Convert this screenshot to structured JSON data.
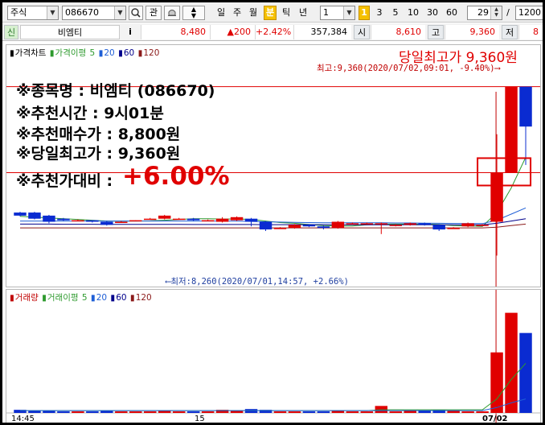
{
  "toolbar": {
    "market_select": "주식",
    "stock_code": "086670",
    "search_icon": "magnifier-icon",
    "btn_watch": "관",
    "period_tabs": [
      "일",
      "주",
      "월",
      "분",
      "틱",
      "년"
    ],
    "interval_value": "1",
    "minute_presets": [
      "3",
      "5",
      "10",
      "30",
      "60"
    ],
    "count_value": "29",
    "slash": "/",
    "total_value": "1200",
    "colors": {
      "active_tab": "#f5c000",
      "up": "#e00000",
      "down": "#0a2bd1"
    }
  },
  "quote": {
    "badge": "신",
    "stock_name": "비엠티",
    "info_btn": "i",
    "price": "8,480",
    "change": "▲200",
    "change_pct": "+2.42%",
    "volume": "357,384",
    "open_label": "시",
    "open": "8,610",
    "high_label": "고",
    "high": "9,360",
    "low_label": "저",
    "low": "8"
  },
  "price_legend": {
    "chart_label": "가격차트",
    "ma_label": "가격이평",
    "ma5": "5",
    "ma20": "20",
    "ma60": "60",
    "ma120": "120"
  },
  "vol_legend": {
    "chart_label": "거래량",
    "ma_label": "거래이평",
    "ma5": "5",
    "ma20": "20",
    "ma60": "60",
    "ma120": "120"
  },
  "annotations": {
    "max_label": "최고:9,360(2020/07/02,09:01, -9.40%)⟶",
    "min_label": "⟵최저:8,260(2020/07/01,14:57, +2.66%)",
    "daily_high_title": "당일최고가 9,360원"
  },
  "overlay": {
    "line1": "※종목명 : 비엠티 (086670)",
    "line2": "※추천시간 : 9시01분",
    "line3": "※추천매수가 : 8,800원",
    "line4": "※당일최고가 : 9,360원",
    "line5_label": "※추천가대비 :",
    "line5_value": "+6.00%"
  },
  "xaxis": {
    "ticks": [
      "14:45",
      "15",
      "07/02"
    ]
  },
  "chart_data": {
    "type": "candlestick",
    "price_range": [
      8100,
      9400
    ],
    "candles": [
      {
        "o": 8540,
        "c": 8520,
        "h": 8545,
        "l": 8515
      },
      {
        "o": 8540,
        "c": 8500,
        "h": 8545,
        "l": 8495
      },
      {
        "o": 8520,
        "c": 8480,
        "h": 8525,
        "l": 8470
      },
      {
        "o": 8500,
        "c": 8490,
        "h": 8505,
        "l": 8485
      },
      {
        "o": 8490,
        "c": 8490,
        "h": 8495,
        "l": 8485
      },
      {
        "o": 8490,
        "c": 8480,
        "h": 8490,
        "l": 8475
      },
      {
        "o": 8480,
        "c": 8460,
        "h": 8485,
        "l": 8455
      },
      {
        "o": 8480,
        "c": 8480,
        "h": 8485,
        "l": 8475
      },
      {
        "o": 8490,
        "c": 8490,
        "h": 8490,
        "l": 8485
      },
      {
        "o": 8500,
        "c": 8500,
        "h": 8505,
        "l": 8495
      },
      {
        "o": 8500,
        "c": 8520,
        "h": 8525,
        "l": 8495
      },
      {
        "o": 8500,
        "c": 8500,
        "h": 8505,
        "l": 8495
      },
      {
        "o": 8500,
        "c": 8490,
        "h": 8505,
        "l": 8485
      },
      {
        "o": 8490,
        "c": 8490,
        "h": 8495,
        "l": 8485
      },
      {
        "o": 8480,
        "c": 8500,
        "h": 8510,
        "l": 8475
      },
      {
        "o": 8490,
        "c": 8510,
        "h": 8515,
        "l": 8485
      },
      {
        "o": 8500,
        "c": 8480,
        "h": 8505,
        "l": 8450
      },
      {
        "o": 8480,
        "c": 8430,
        "h": 8485,
        "l": 8420
      },
      {
        "o": 8440,
        "c": 8440,
        "h": 8445,
        "l": 8435
      },
      {
        "o": 8440,
        "c": 8460,
        "h": 8465,
        "l": 8435
      },
      {
        "o": 8460,
        "c": 8450,
        "h": 8465,
        "l": 8445
      },
      {
        "o": 8450,
        "c": 8440,
        "h": 8455,
        "l": 8430
      },
      {
        "o": 8440,
        "c": 8480,
        "h": 8485,
        "l": 8435
      },
      {
        "o": 8470,
        "c": 8470,
        "h": 8475,
        "l": 8465
      },
      {
        "o": 8470,
        "c": 8470,
        "h": 8475,
        "l": 8465
      },
      {
        "o": 8470,
        "c": 8470,
        "h": 8475,
        "l": 8400
      },
      {
        "o": 8460,
        "c": 8460,
        "h": 8465,
        "l": 8450
      },
      {
        "o": 8460,
        "c": 8470,
        "h": 8475,
        "l": 8455
      },
      {
        "o": 8470,
        "c": 8460,
        "h": 8475,
        "l": 8455
      },
      {
        "o": 8460,
        "c": 8430,
        "h": 8465,
        "l": 8420
      },
      {
        "o": 8440,
        "c": 8440,
        "h": 8445,
        "l": 8435
      },
      {
        "o": 8450,
        "c": 8470,
        "h": 8475,
        "l": 8445
      },
      {
        "o": 8460,
        "c": 8460,
        "h": 8465,
        "l": 8455
      },
      {
        "o": 8480,
        "c": 8800,
        "h": 9050,
        "l": 8260
      },
      {
        "o": 8800,
        "c": 9360,
        "h": 9360,
        "l": 8800
      },
      {
        "o": 9360,
        "c": 9100,
        "h": 9360,
        "l": 8850
      }
    ],
    "volumes": [
      4,
      3,
      3,
      2,
      2,
      2,
      3,
      2,
      2,
      2,
      3,
      2,
      2,
      2,
      4,
      3,
      5,
      4,
      2,
      2,
      2,
      2,
      3,
      2,
      2,
      9,
      2,
      3,
      3,
      4,
      3,
      2,
      2,
      78,
      129,
      103
    ],
    "volume_range": [
      0,
      140
    ],
    "ma5": [
      8515,
      8510,
      8505,
      8500,
      8495,
      8490,
      8485,
      8485,
      8485,
      8486,
      8490,
      8495,
      8500,
      8500,
      8498,
      8498,
      8496,
      8485,
      8475,
      8470,
      8462,
      8455,
      8452,
      8452,
      8460,
      8465,
      8465,
      8465,
      8465,
      8462,
      8455,
      8452,
      8450,
      8540,
      8700,
      8900
    ],
    "ma20": [
      8485,
      8485,
      8485,
      8485,
      8485,
      8485,
      8485,
      8485,
      8485,
      8485,
      8485,
      8485,
      8485,
      8485,
      8485,
      8485,
      8482,
      8480,
      8478,
      8476,
      8475,
      8474,
      8474,
      8474,
      8474,
      8473,
      8472,
      8472,
      8471,
      8470,
      8469,
      8468,
      8468,
      8490,
      8530,
      8570
    ],
    "ma60": [
      8465,
      8465,
      8465,
      8464,
      8464,
      8464,
      8463,
      8463,
      8463,
      8463,
      8463,
      8463,
      8462,
      8462,
      8462,
      8462,
      8462,
      8461,
      8461,
      8461,
      8461,
      8461,
      8461,
      8461,
      8460,
      8460,
      8460,
      8460,
      8460,
      8460,
      8460,
      8460,
      8460,
      8470,
      8485,
      8500
    ],
    "ma120": [
      8440,
      8440,
      8440,
      8440,
      8440,
      8440,
      8440,
      8440,
      8440,
      8440,
      8440,
      8440,
      8440,
      8440,
      8440,
      8440,
      8440,
      8440,
      8440,
      8440,
      8440,
      8440,
      8440,
      8440,
      8440,
      8440,
      8440,
      8440,
      8440,
      8440,
      8440,
      8440,
      8440,
      8445,
      8455,
      8465
    ],
    "vol_ma5": [
      3,
      3,
      3,
      3,
      3,
      3,
      3,
      3,
      3,
      3,
      3,
      3,
      3,
      3,
      3,
      3,
      3,
      3,
      3,
      3,
      3,
      3,
      3,
      3,
      3,
      4,
      4,
      4,
      4,
      4,
      4,
      4,
      4,
      18,
      43,
      64
    ],
    "vol_ma20": [
      3,
      3,
      3,
      3,
      3,
      3,
      3,
      3,
      3,
      3,
      3,
      3,
      3,
      3,
      3,
      3,
      3,
      3,
      3,
      3,
      3,
      3,
      3,
      3,
      3,
      3,
      3,
      3,
      3,
      3,
      3,
      3,
      3,
      7,
      13,
      18
    ],
    "max_value": 9360,
    "min_value": 8260,
    "recommend_buy": 8800
  }
}
